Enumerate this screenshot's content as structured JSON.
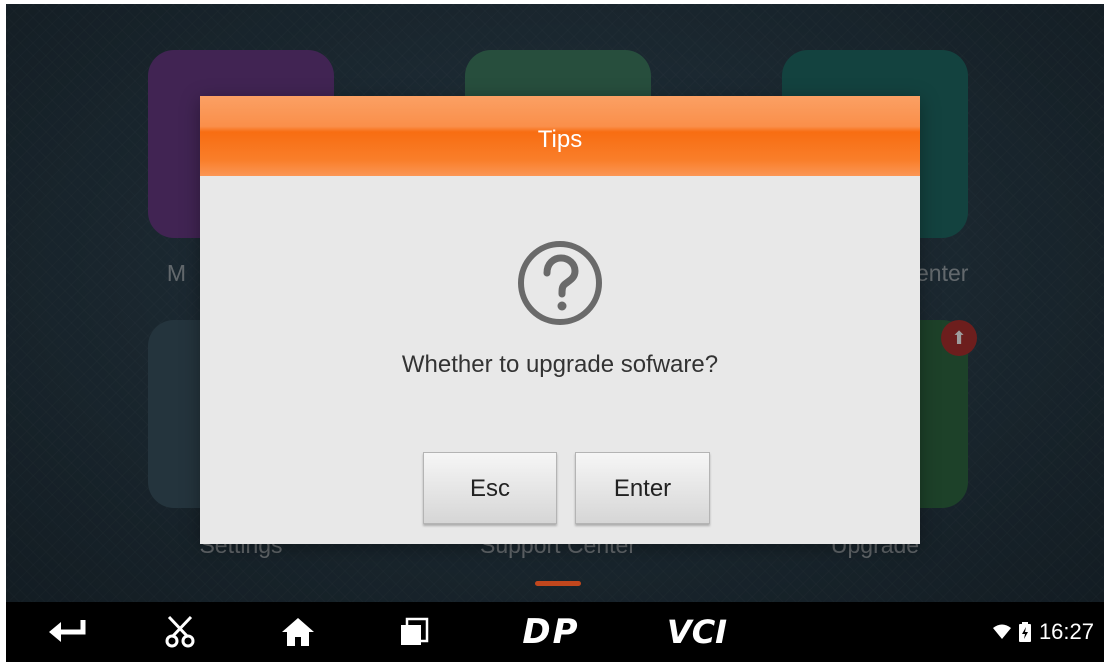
{
  "home": {
    "apps": [
      {
        "label": "M",
        "color": "#6a3a86"
      },
      {
        "label": "",
        "color": "#3f7f63"
      },
      {
        "label": "enter",
        "color": "#1f6b66"
      },
      {
        "label": "Settings",
        "color": "#3b5563"
      },
      {
        "label": "Support Center",
        "color": "#2f4a58"
      },
      {
        "label": "Upgrade",
        "color": "#2f6a43"
      }
    ]
  },
  "dialog": {
    "title": "Tips",
    "message": "Whether to upgrade sofware?",
    "icon": "question-circle-icon",
    "esc_label": "Esc",
    "enter_label": "Enter",
    "header_color": "#f97e2a"
  },
  "navbar": {
    "logo_dp": "DP",
    "logo_vci": "VCI",
    "time": "16:27"
  }
}
